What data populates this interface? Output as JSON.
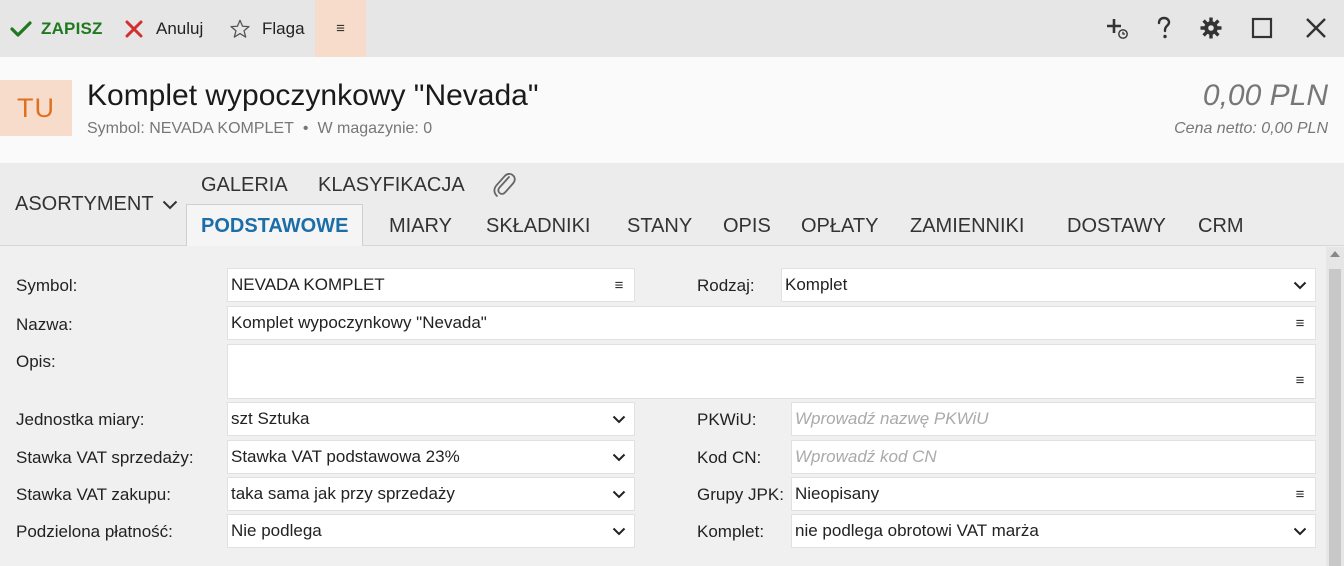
{
  "toolbar": {
    "save_label": "ZAPISZ",
    "cancel_label": "Anuluj",
    "flag_label": "Flaga",
    "menu_glyph": "≡",
    "icons": [
      "add-linked-icon",
      "help-icon",
      "settings-icon",
      "maximize-icon",
      "close-icon"
    ]
  },
  "header": {
    "avatar_text": "TU",
    "title": "Komplet wypoczynkowy \"Nevada\"",
    "symbol_text": "Symbol: NEVADA KOMPLET",
    "separator": "•",
    "stock_text": "W magazynie: 0",
    "price": "0,00 PLN",
    "price_net": "Cena netto: 0,00 PLN"
  },
  "tabs": {
    "asortyment": "ASORTYMENT",
    "top": [
      "GALERIA",
      "KLASYFIKACJA"
    ],
    "main": [
      "PODSTAWOWE",
      "MIARY",
      "SKŁADNIKI",
      "STANY",
      "OPIS",
      "OPŁATY",
      "ZAMIENNIKI",
      "DOSTAWY",
      "CRM"
    ],
    "active": "PODSTAWOWE"
  },
  "form": {
    "symbol_label": "Symbol:",
    "symbol_value": "NEVADA KOMPLET",
    "nazwa_label": "Nazwa:",
    "nazwa_value": "Komplet wypoczynkowy \"Nevada\"",
    "opis_label": "Opis:",
    "opis_value": "",
    "jm_label": "Jednostka miary:",
    "jm_value": "szt  Sztuka",
    "vat_sprz_label": "Stawka VAT sprzedaży:",
    "vat_sprz_value": "Stawka VAT podstawowa 23%",
    "vat_zak_label": "Stawka VAT zakupu:",
    "vat_zak_value": "taka sama jak przy sprzedaży",
    "podz_label": "Podzielona płatność:",
    "podz_value": "Nie podlega",
    "rodzaj_label": "Rodzaj:",
    "rodzaj_value": "Komplet",
    "pkwiu_label": "PKWiU:",
    "pkwiu_placeholder": "Wprowadź nazwę PKWiU",
    "kodcn_label": "Kod CN:",
    "kodcn_placeholder": "Wprowadź kod CN",
    "jpk_label": "Grupy JPK:",
    "jpk_value": "Nieopisany",
    "komplet_label": "Komplet:",
    "komplet_value": "nie podlega obrotowi VAT marża"
  },
  "colors": {
    "accent": "#1b6ea8",
    "save_green": "#1f7a1f",
    "cancel_red": "#d32f2f",
    "avatar_bg": "#f8dccb",
    "avatar_fg": "#e07020"
  }
}
